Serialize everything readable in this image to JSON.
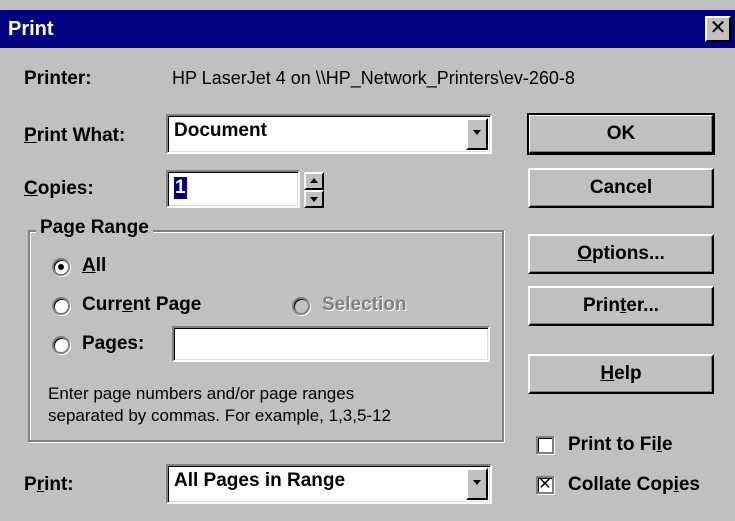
{
  "window": {
    "title": "Print",
    "close_glyph": "✕"
  },
  "printer": {
    "label": "Printer:",
    "value": "HP LaserJet 4 on \\\\HP_Network_Printers\\ev-260-8"
  },
  "print_what": {
    "label_prefix": "",
    "label_mnemonic": "P",
    "label_rest": "rint What:",
    "value": "Document"
  },
  "copies": {
    "label_mnemonic": "C",
    "label_rest": "opies:",
    "value": "1"
  },
  "page_range": {
    "title": "Page Range",
    "all": {
      "mnemonic": "A",
      "rest": "ll",
      "selected": true
    },
    "current_page": {
      "pre": "Curr",
      "mnemonic": "e",
      "post": "nt Page",
      "selected": false
    },
    "selection": {
      "label": "Selection",
      "enabled": false
    },
    "pages": {
      "pre": "Pa",
      "mnemonic": "g",
      "post": "es:",
      "value": "",
      "selected": false
    },
    "help_line1": "Enter page numbers and/or page ranges",
    "help_line2": "separated by commas.  For example, 1,3,5-12"
  },
  "print": {
    "pre": "P",
    "mnemonic": "r",
    "post": "int:",
    "value": "All Pages in Range"
  },
  "buttons": {
    "ok": "OK",
    "cancel": "Cancel",
    "options_mnemonic": "O",
    "options_rest": "ptions...",
    "printer_pre": "Prin",
    "printer_mnemonic": "t",
    "printer_post": "er...",
    "help_mnemonic": "H",
    "help_rest": "elp"
  },
  "checkboxes": {
    "print_to_file": {
      "pre": "Print to Fi",
      "mnemonic": "l",
      "post": "e",
      "checked": false
    },
    "collate": {
      "pre": "Collate Cop",
      "mnemonic": "i",
      "post": "es",
      "checked": true,
      "mark": "✕"
    }
  },
  "colors": {
    "titlebar": "#000080",
    "face": "#c0c0c0",
    "field": "#ffffff",
    "selection": "#000080"
  }
}
